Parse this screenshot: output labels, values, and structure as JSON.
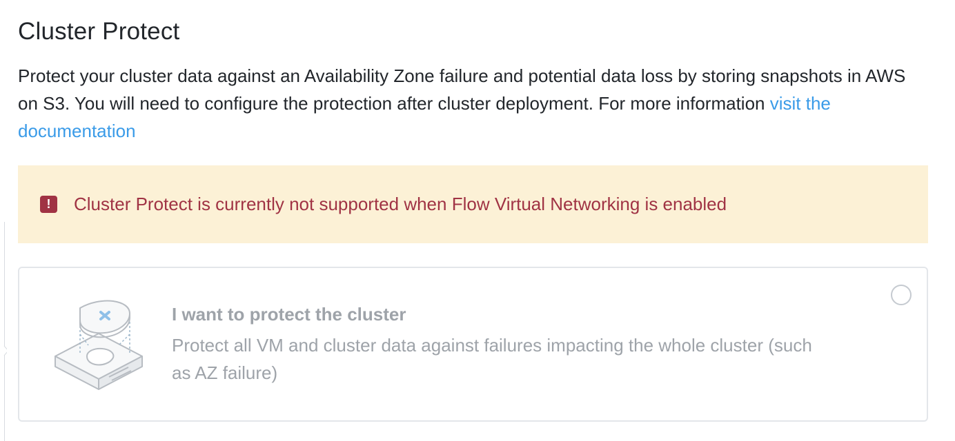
{
  "section": {
    "title": "Cluster Protect",
    "description": "Protect your cluster data against an Availability Zone failure and potential data loss by storing snapshots in AWS on S3. You will need to configure the protection after cluster deployment. For more information ",
    "link_text": "visit the documentation"
  },
  "warning": {
    "icon": "exclamation-icon",
    "icon_glyph": "!",
    "message": "Cluster Protect is currently not supported when Flow Virtual Networking is enabled",
    "background_color": "#fcf1d6",
    "text_color": "#a03344"
  },
  "option": {
    "icon": "protected-cluster-illustration",
    "title": "I want to protect the cluster",
    "description": "Protect all VM and cluster data against failures impacting the whole cluster (such as AZ failure)",
    "selected": false,
    "disabled": true
  },
  "colors": {
    "link": "#3a9be8",
    "text": "#22262b",
    "muted_text": "#9ea3a9"
  }
}
